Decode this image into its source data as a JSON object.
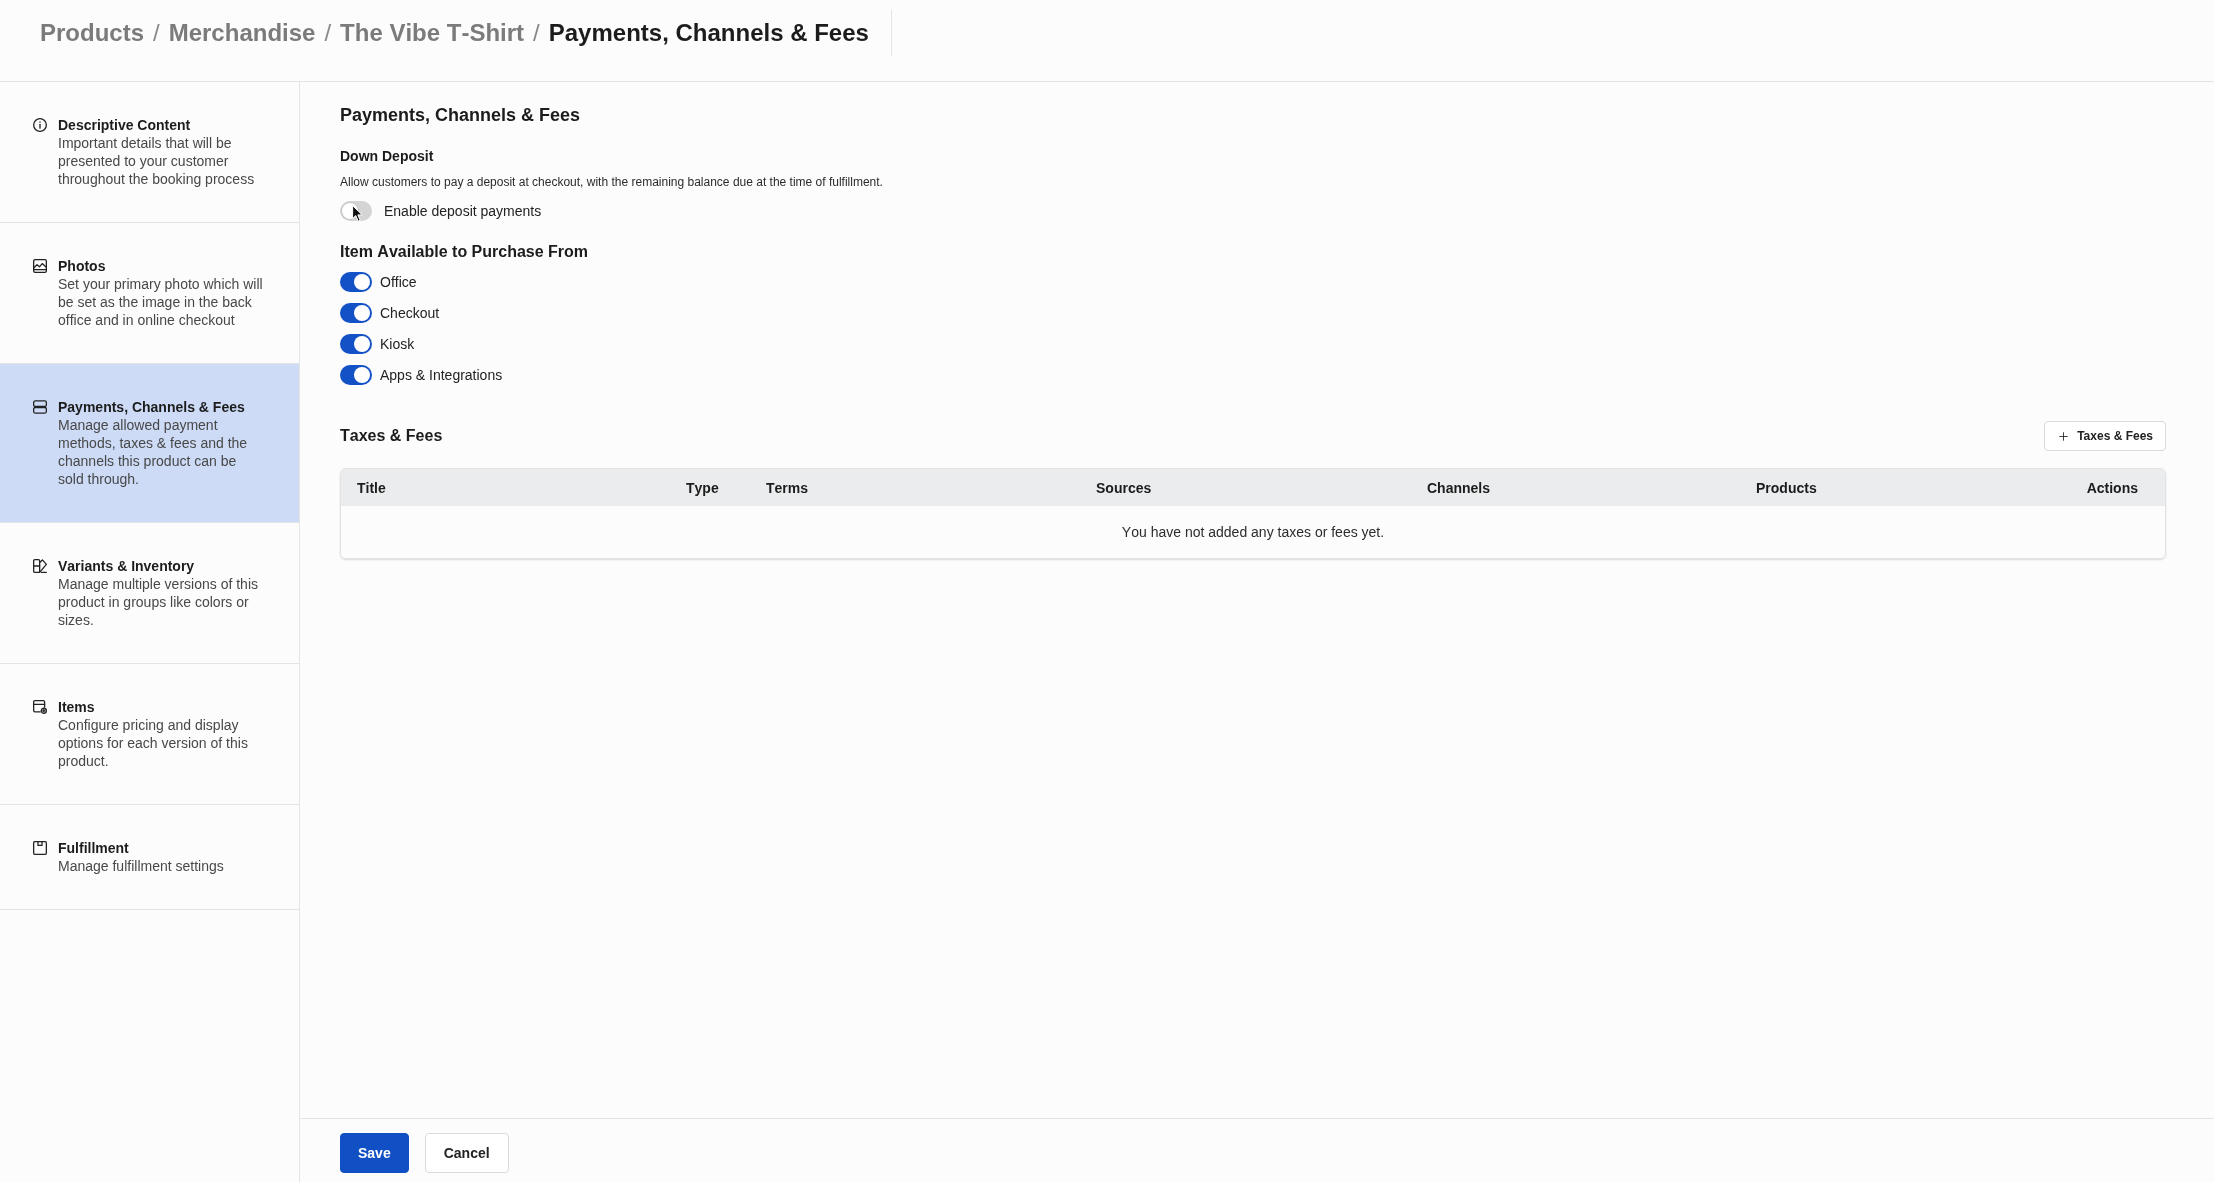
{
  "breadcrumb": [
    {
      "label": "Products",
      "current": false,
      "separator": "/"
    },
    {
      "label": "Merchandise",
      "current": false,
      "separator": "/"
    },
    {
      "label": "The Vibe T-Shirt",
      "current": false,
      "separator": "/"
    },
    {
      "label": "Payments, Channels & Fees",
      "current": true
    }
  ],
  "sidebar": {
    "items": [
      {
        "kind": "info",
        "title": "Descriptive Content",
        "description": "Important details that will be presented to your customer throughout the booking process",
        "selected": false
      },
      {
        "kind": "image",
        "title": "Photos",
        "description": "Set your primary photo which will be set as the image in the back office and in online checkout",
        "selected": false
      },
      {
        "kind": "stack",
        "title": "Payments, Channels & Fees",
        "description": "Manage allowed payment methods, taxes & fees and the channels this product can be sold through.",
        "selected": true
      },
      {
        "kind": "variants",
        "title": "Variants & Inventory",
        "description": "Manage multiple versions of this product in groups like colors or sizes.",
        "selected": false
      },
      {
        "kind": "items",
        "title": "Items",
        "description": "Configure pricing and display options for each version of this product.",
        "selected": false
      },
      {
        "kind": "fulfillment",
        "title": "Fulfillment",
        "description": "Manage fulfillment settings",
        "selected": false
      }
    ]
  },
  "content": {
    "title": "Payments, Channels & Fees",
    "down_deposit": {
      "title": "Down Deposit",
      "description": "Allow customers to pay a deposit at checkout, with the remaining balance due at the time of fulfillment.",
      "toggle": {
        "label": "Enable deposit payments",
        "on": false
      }
    },
    "channels": {
      "title": "Item Available to Purchase From",
      "toggles": [
        {
          "label": "Office",
          "on": true
        },
        {
          "label": "Checkout",
          "on": true
        },
        {
          "label": "Kiosk",
          "on": true
        },
        {
          "label": "Apps & Integrations",
          "on": true
        }
      ]
    },
    "taxes_fees": {
      "title": "Taxes & Fees",
      "add_button": "Taxes & Fees",
      "table": {
        "columns": [
          "Title",
          "Type",
          "Terms",
          "Sources",
          "Channels",
          "Products",
          "Actions"
        ],
        "empty_message": "You have not added any taxes or fees yet."
      }
    }
  },
  "footer": {
    "buttons": [
      {
        "label": "Save",
        "kind": "primary"
      },
      {
        "label": "Cancel",
        "kind": "secondary"
      }
    ]
  }
}
